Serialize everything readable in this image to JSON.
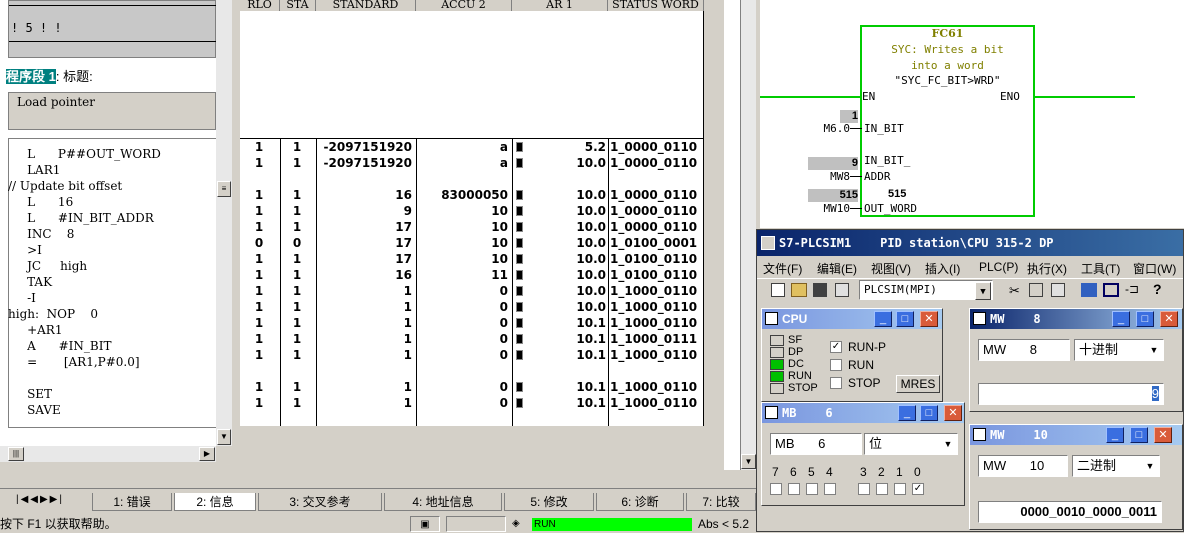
{
  "left": {
    "top_text": "! 5 !        !",
    "network_title_hl": "程序段 1",
    "network_title_rest": ": 标题:",
    "comment": "Load pointer",
    "code": [
      "     L      P##OUT_WORD",
      "     LAR1",
      "// Update bit offset",
      "     L      16",
      "     L      #IN_BIT_ADDR",
      "     INC    8",
      "     >I",
      "     JC     high",
      "     TAK",
      "     -I",
      "high:  NOP    0",
      "     +AR1",
      "     A      #IN_BIT",
      "     =       [AR1,P#0.0]",
      "",
      "     SET",
      "     SAVE"
    ]
  },
  "table": {
    "headers": [
      "RLO",
      "STA",
      "STANDARD",
      "ACCU 2",
      "AR 1",
      "STATUS WORD"
    ],
    "rows": [
      [
        "1",
        "1",
        "-2097151920",
        "a",
        "5.2",
        "1_0000_0110"
      ],
      [
        "1",
        "1",
        "-2097151920",
        "a",
        "10.0",
        "1_0000_0110"
      ],
      [
        "",
        "",
        "",
        "",
        "",
        ""
      ],
      [
        "1",
        "1",
        "16",
        "83000050",
        "10.0",
        "1_0000_0110"
      ],
      [
        "1",
        "1",
        "9",
        "10",
        "10.0",
        "1_0000_0110"
      ],
      [
        "1",
        "1",
        "17",
        "10",
        "10.0",
        "1_0000_0110"
      ],
      [
        "0",
        "0",
        "17",
        "10",
        "10.0",
        "1_0100_0001"
      ],
      [
        "1",
        "1",
        "17",
        "10",
        "10.0",
        "1_0100_0110"
      ],
      [
        "1",
        "1",
        "16",
        "11",
        "10.0",
        "1_0100_0110"
      ],
      [
        "1",
        "1",
        "1",
        "0",
        "10.0",
        "1_1000_0110"
      ],
      [
        "1",
        "1",
        "1",
        "0",
        "10.0",
        "1_1000_0110"
      ],
      [
        "1",
        "1",
        "1",
        "0",
        "10.1",
        "1_1000_0110"
      ],
      [
        "1",
        "1",
        "1",
        "0",
        "10.1",
        "1_1000_0111"
      ],
      [
        "1",
        "1",
        "1",
        "0",
        "10.1",
        "1_1000_0110"
      ],
      [
        "",
        "",
        "",
        "",
        "",
        ""
      ],
      [
        "1",
        "1",
        "1",
        "0",
        "10.1",
        "1_1000_0110"
      ],
      [
        "1",
        "1",
        "1",
        "0",
        "10.1",
        "1_1000_0110"
      ]
    ]
  },
  "ladder": {
    "block": "FC61",
    "desc1": "SYC: Writes a bit",
    "desc2": "into a word",
    "desc3": "\"SYC_FC_BIT>WRD\"",
    "en": "EN",
    "eno": "ENO",
    "in1_val": "1",
    "in1_addr": "M6.0",
    "in1_pin": "IN_BIT",
    "in2_val": "9",
    "in2_pin": "IN_BIT_",
    "in2_addr": "MW8",
    "in2_pin2": "ADDR",
    "out_val_l": "515",
    "out_val_r": "515",
    "out_addr": "MW10",
    "out_pin": "OUT_WORD"
  },
  "plcsim": {
    "title": "S7-PLCSIM1    PID station\\CPU 315-2 DP",
    "menu": [
      "文件(F)",
      "编辑(E)",
      "视图(V)",
      "插入(I)",
      "PLC(P)",
      "执行(X)",
      "工具(T)",
      "窗口(W)"
    ],
    "conn": "PLCSIM(MPI)",
    "cpu": {
      "title": "CPU",
      "leds": [
        "SF",
        "DP",
        "DC",
        "RUN",
        "STOP"
      ],
      "modes": [
        "RUN-P",
        "RUN",
        "STOP"
      ],
      "mres": "MRES"
    },
    "mw8": {
      "title": "MW    8",
      "addr_type": "MW",
      "addr": "8",
      "format": "十进制",
      "value": "9"
    },
    "mb6": {
      "title": "MB    6",
      "addr_type": "MB",
      "addr": "6",
      "format": "位",
      "bits": [
        "7",
        "6",
        "5",
        "4",
        "3",
        "2",
        "1",
        "0"
      ]
    },
    "mw10": {
      "title": "MW    10",
      "addr_type": "MW",
      "addr": "10",
      "format": "二进制",
      "value": "0000_0010_0000_0011"
    }
  },
  "tabs": [
    "1: 错误",
    "2: 信息",
    "3: 交叉参考",
    "4: 地址信息",
    "5: 修改",
    "6: 诊断",
    "7: 比较"
  ],
  "status": {
    "help": "按下 F1 以获取帮助。",
    "run": "RUN",
    "abs": "Abs < 5.2"
  },
  "colors": {
    "run_green": "#00ff00",
    "title_blue": "#0a246a",
    "network_hl": "#008080"
  }
}
